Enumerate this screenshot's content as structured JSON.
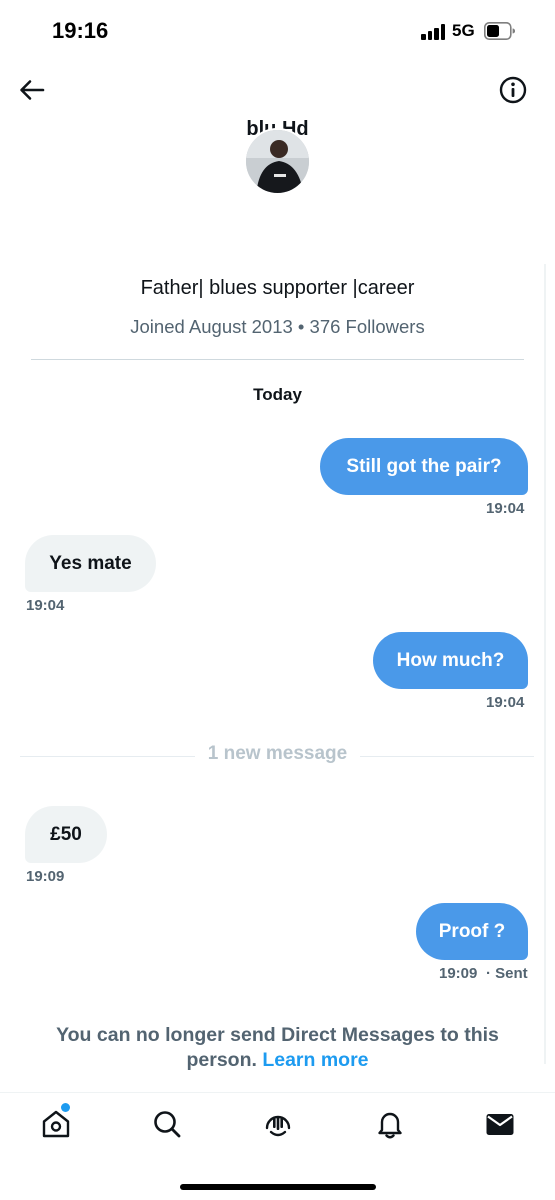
{
  "status_bar": {
    "time": "19:16",
    "network": "5G"
  },
  "header": {
    "back_icon": "arrow-left-icon",
    "info_icon": "info-icon",
    "profile_name": "blu     Hd"
  },
  "profile": {
    "bio": "Father| blues supporter |career",
    "meta": "Joined August 2013 • 376 Followers"
  },
  "conversation": {
    "day_label": "Today",
    "messages": [
      {
        "direction": "out",
        "text": "Still got the pair?",
        "time": "19:04"
      },
      {
        "direction": "in",
        "text": "Yes mate",
        "time": "19:04"
      },
      {
        "direction": "out",
        "text": "How much?",
        "time": "19:04"
      },
      {
        "direction": "in",
        "text": "£50",
        "time": "19:09"
      },
      {
        "direction": "out",
        "text": "Proof ?",
        "time": "19:09",
        "status": "· Sent"
      }
    ],
    "new_message_divider": "1 new message"
  },
  "notice": {
    "text": "You can no longer send Direct Messages to this person.",
    "link": "Learn more"
  },
  "bottom_nav": {
    "items": [
      "home-icon",
      "search-icon",
      "spaces-icon",
      "bell-icon",
      "mail-icon"
    ],
    "accent_color": "#1d9bf0"
  },
  "colors": {
    "outgoing_bubble": "#4a99e9",
    "incoming_bubble": "#eff3f4",
    "secondary_text": "#536471",
    "link": "#1d9bf0"
  }
}
